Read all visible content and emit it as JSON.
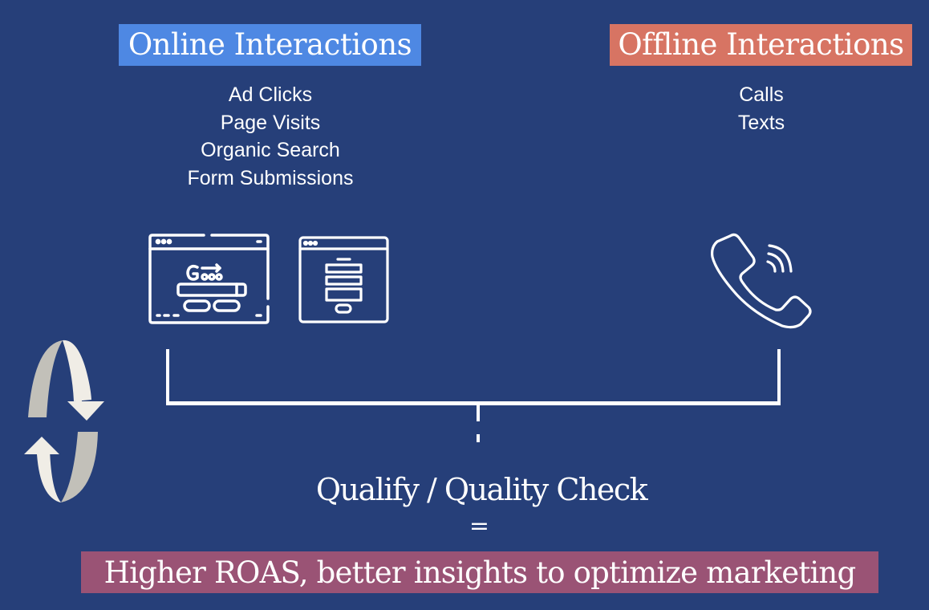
{
  "colors": {
    "background": "#263f79",
    "online_highlight": "#4e88e3",
    "offline_highlight": "#d77463",
    "result_highlight": "#9a5375",
    "icon_stroke": "#ffffff",
    "arrow_light": "#f0ede6",
    "arrow_shade": "#c2c0b9"
  },
  "online": {
    "title": "Online Interactions",
    "items": [
      "Ad Clicks",
      "Page Visits",
      "Organic Search",
      "Form Submissions"
    ],
    "icons": [
      "search-engine-browser-icon",
      "web-form-browser-icon"
    ]
  },
  "offline": {
    "title": "Offline Interactions",
    "items": [
      "Calls",
      "Texts"
    ],
    "icons": [
      "phone-call-icon"
    ]
  },
  "process": {
    "cycle_icon": "refresh-cycle-arrows-icon",
    "step": "Qualify / Quality Check",
    "operator": "=",
    "result": "Higher ROAS, better insights to optimize marketing"
  }
}
